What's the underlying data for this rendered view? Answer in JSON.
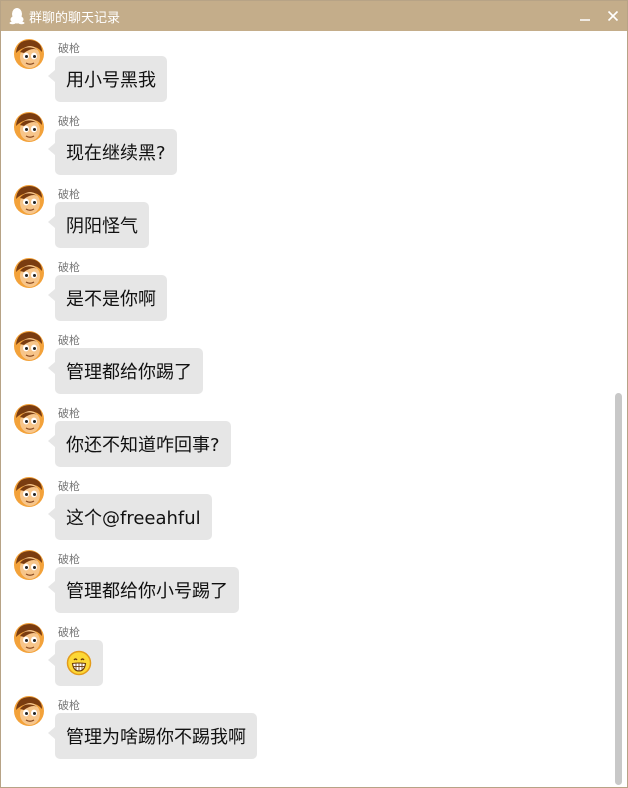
{
  "window": {
    "title": "群聊的聊天记录",
    "minimize_icon": "minimize-icon",
    "close_icon": "close-icon"
  },
  "messages": [
    {
      "sender": "破枪",
      "text": "用小号黑我"
    },
    {
      "sender": "破枪",
      "text": "现在继续黑?"
    },
    {
      "sender": "破枪",
      "text": "阴阳怪气"
    },
    {
      "sender": "破枪",
      "text": "是不是你啊"
    },
    {
      "sender": "破枪",
      "text": "管理都给你踢了"
    },
    {
      "sender": "破枪",
      "text": "你还不知道咋回事?"
    },
    {
      "sender": "破枪",
      "text": "这个@freeahful"
    },
    {
      "sender": "破枪",
      "text": "管理都给你小号踢了"
    },
    {
      "sender": "破枪",
      "text": "",
      "emoji": "grinning-face-emoji"
    },
    {
      "sender": "破枪",
      "text": "管理为啥踢你不踢我啊"
    }
  ],
  "colors": {
    "titlebar": "#c4ad8a",
    "bubble": "#e6e6e6",
    "scrollbar": "#c8c8c8"
  }
}
